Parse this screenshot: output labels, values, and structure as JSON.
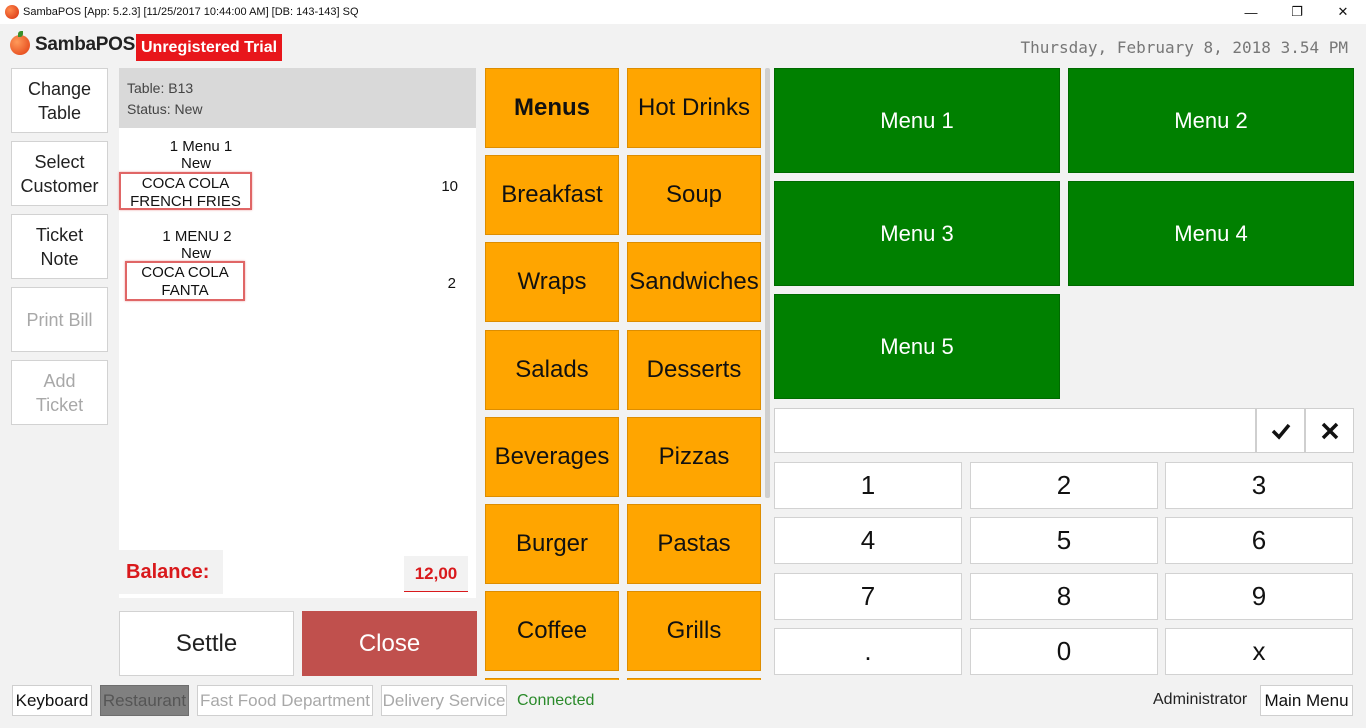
{
  "window": {
    "title": "SambaPOS [App: 5.2.3] [11/25/2017 10:44:00 AM] [DB: 143-143] SQ",
    "controls": [
      "—",
      "❐",
      "✕"
    ]
  },
  "header": {
    "logo": "SambaPOS",
    "trial": "Unregistered Trial",
    "datetime": "Thursday, February 8, 2018 3.54 PM"
  },
  "side": {
    "change_table": "Change\nTable",
    "select_customer": "Select\nCustomer",
    "ticket_note": "Ticket\nNote",
    "print_bill": "Print Bill",
    "add_ticket": "Add\nTicket"
  },
  "ticket": {
    "table": "Table: B13",
    "status": "Status: New",
    "orders": [
      {
        "name": "1 Menu 1",
        "status": "New",
        "items": [
          "COCA COLA",
          "FRENCH FRIES"
        ],
        "price": "10"
      },
      {
        "name": "1 MENU 2",
        "status": "New",
        "items": [
          "COCA COLA",
          "FANTA"
        ],
        "price": "2"
      }
    ],
    "balance_label": "Balance:",
    "balance_value": "12,00"
  },
  "actions": {
    "settle": "Settle",
    "close": "Close"
  },
  "categories": [
    "Menus",
    "Hot Drinks",
    "Breakfast",
    "Soup",
    "Wraps",
    "Sandwiches",
    "Salads",
    "Desserts",
    "Beverages",
    "Pizzas",
    "Burger",
    "Pastas",
    "Coffee",
    "Grills"
  ],
  "selected_category": "Menus",
  "menu_items": [
    "Menu 1",
    "Menu 2",
    "Menu 3",
    "Menu 4",
    "Menu 5"
  ],
  "numpad": {
    "ok_icon": "checkmark-icon",
    "cancel_icon": "close-icon",
    "keys": [
      "1",
      "2",
      "3",
      "4",
      "5",
      "6",
      "7",
      "8",
      "9",
      ".",
      "0",
      "x"
    ]
  },
  "footer": {
    "keyboard": "Keyboard",
    "restaurant": "Restaurant",
    "fast_food": "Fast Food Department",
    "delivery": "Delivery Service",
    "connected": "Connected",
    "user": "Administrator",
    "main_menu": "Main Menu"
  },
  "colors": {
    "category": "#ffa500",
    "menu_item": "#008000",
    "close": "#c0504d",
    "trial": "#e8161b",
    "balance": "#d9191c"
  }
}
